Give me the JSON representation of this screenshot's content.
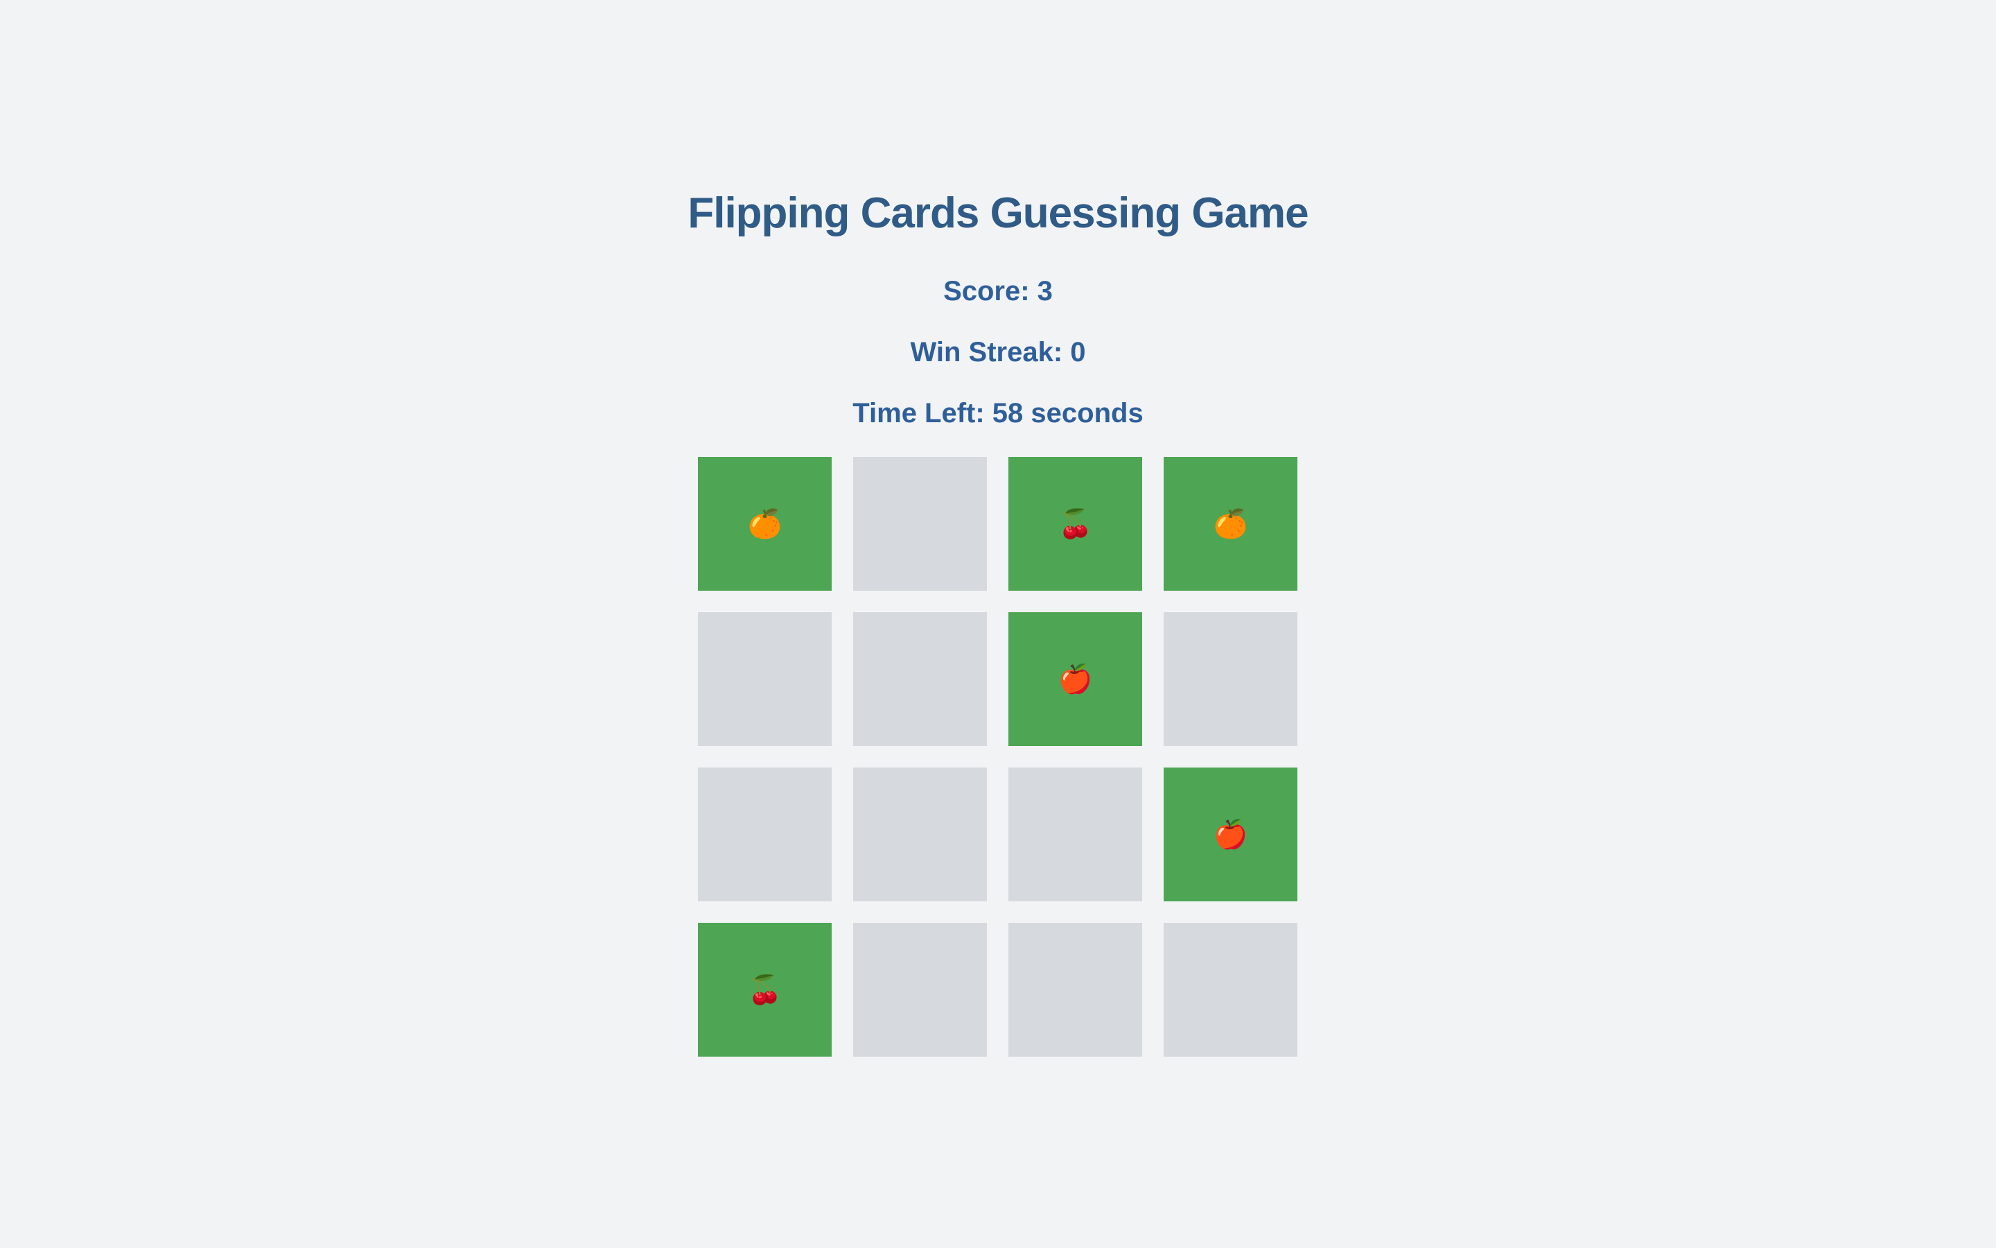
{
  "game": {
    "title": "Flipping Cards Guessing Game",
    "score_text": "Score: 3",
    "streak_text": "Win Streak: 0",
    "time_text": "Time Left: 58 seconds"
  },
  "colors": {
    "revealed": "#4ea553",
    "hidden": "#d6d9dd",
    "heading": "#2f5b86"
  },
  "cards": [
    {
      "state": "revealed",
      "fruit": "orange",
      "symbol": "🍊"
    },
    {
      "state": "hidden",
      "fruit": "",
      "symbol": ""
    },
    {
      "state": "revealed",
      "fruit": "cherries",
      "symbol": "🍒"
    },
    {
      "state": "revealed",
      "fruit": "orange",
      "symbol": "🍊"
    },
    {
      "state": "hidden",
      "fruit": "",
      "symbol": ""
    },
    {
      "state": "hidden",
      "fruit": "",
      "symbol": ""
    },
    {
      "state": "revealed",
      "fruit": "apple",
      "symbol": "🍎"
    },
    {
      "state": "hidden",
      "fruit": "",
      "symbol": ""
    },
    {
      "state": "hidden",
      "fruit": "",
      "symbol": ""
    },
    {
      "state": "hidden",
      "fruit": "",
      "symbol": ""
    },
    {
      "state": "hidden",
      "fruit": "",
      "symbol": ""
    },
    {
      "state": "revealed",
      "fruit": "apple",
      "symbol": "🍎"
    },
    {
      "state": "revealed",
      "fruit": "cherries",
      "symbol": "🍒"
    },
    {
      "state": "hidden",
      "fruit": "",
      "symbol": ""
    },
    {
      "state": "hidden",
      "fruit": "",
      "symbol": ""
    },
    {
      "state": "hidden",
      "fruit": "",
      "symbol": ""
    }
  ]
}
